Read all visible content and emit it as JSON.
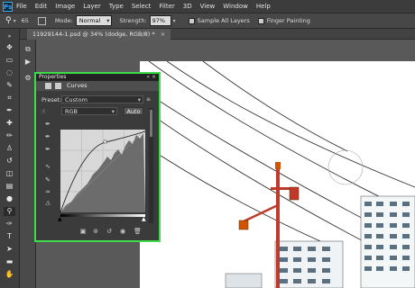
{
  "app": {
    "logo": "Ps"
  },
  "menu": [
    "File",
    "Edit",
    "Image",
    "Layer",
    "Type",
    "Select",
    "Filter",
    "3D",
    "View",
    "Window",
    "Help"
  ],
  "options": {
    "tool_icon": "dodge-tool-icon",
    "brush_size": "65",
    "mode_label": "Mode:",
    "mode_value": "Normal",
    "strength_label": "Strength:",
    "strength_value": "97%",
    "sample_all_layers": "Sample All Layers",
    "finger_painting": "Finger Painting"
  },
  "document": {
    "tab": "11929144-1.psd @ 34% (dodge, RGB/8) *"
  },
  "properties": {
    "title": "Properties",
    "panel_name": "Curves",
    "preset_label": "Preset:",
    "preset_value": "Custom",
    "channel_value": "RGB",
    "auto_label": "Auto"
  },
  "colors": {
    "highlight": "#3ddc4a",
    "pole": "#c0392b",
    "canvas": "#ffffff"
  }
}
